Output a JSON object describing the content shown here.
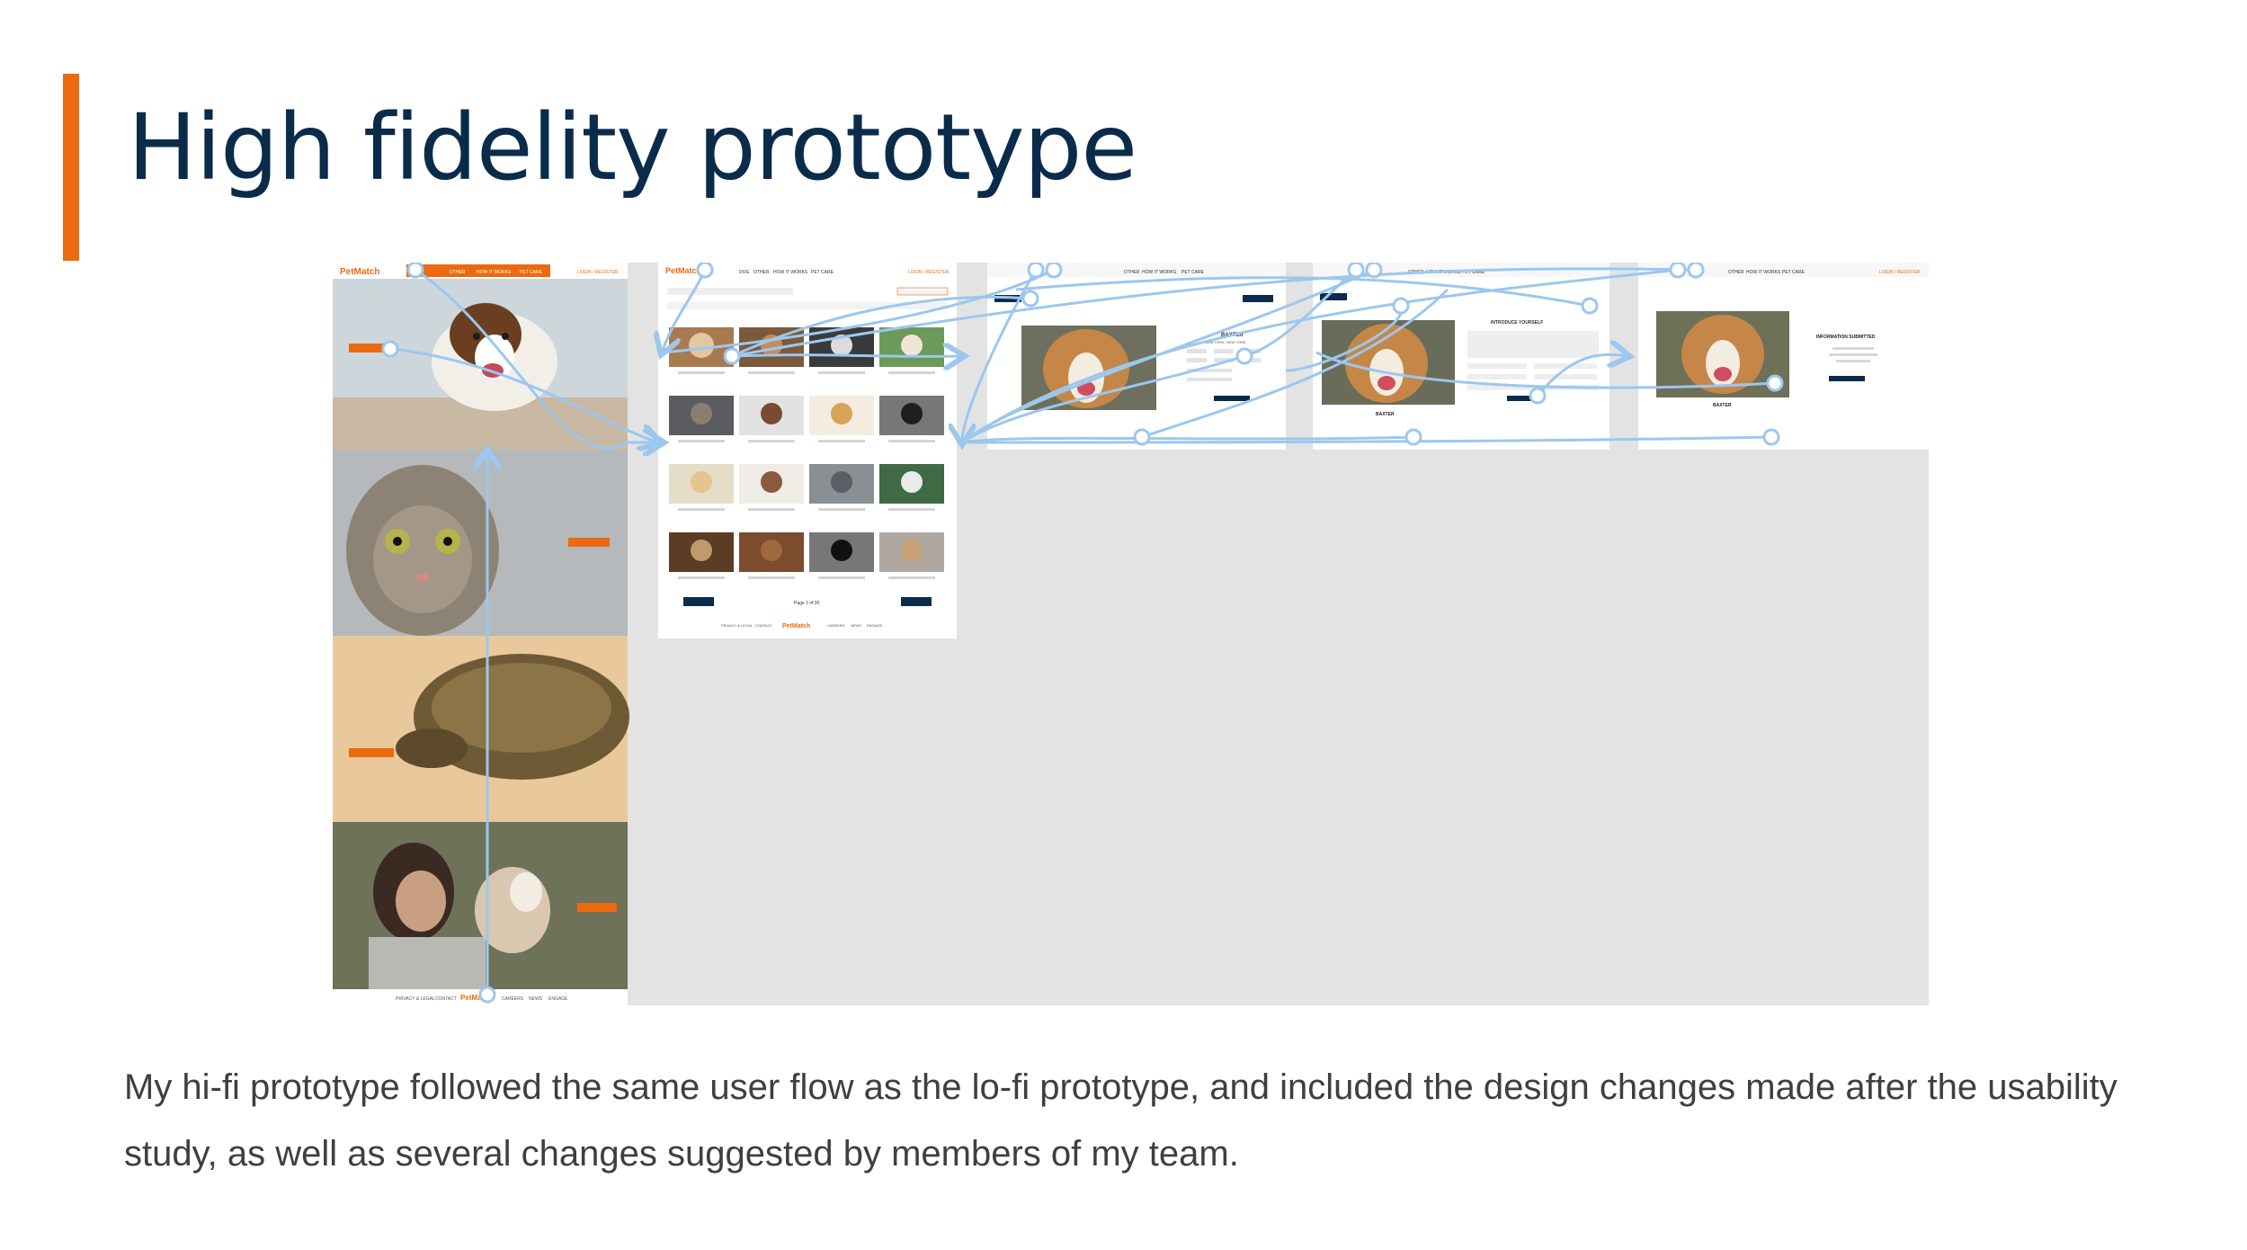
{
  "slide": {
    "title": "High fidelity prototype",
    "description": "My hi-fi prototype followed the same user flow as the lo-fi prototype, and included the design changes made after the usability study, as well as several changes suggested by members of my team."
  },
  "colors": {
    "accent": "#ec6a0f",
    "title": "#0b2b4a",
    "body_text": "#3f3f3f",
    "board_bg": "#e3e3e3",
    "flow_line": "#9cc7ee",
    "navy_button": "#0b2b4a"
  },
  "prototype": {
    "brand": "PetMatch",
    "nav": [
      "DOG",
      "OTHER",
      "HOW IT WORKS",
      "PET CARE"
    ],
    "login": "LOGIN / REGISTER",
    "pet_name": "BAXTER",
    "pet_location": "NEW YORK, NEW YORK",
    "introduce_heading": "INTRODUCE YOURSELF",
    "submitted_heading": "INFORMATION SUBMITTED",
    "pagination": "Page 1 of 30",
    "footer_links": [
      "PRIVACY & LEGAL",
      "CONTACT",
      "CAREERS",
      "NEWS",
      "ENGAGE"
    ]
  }
}
